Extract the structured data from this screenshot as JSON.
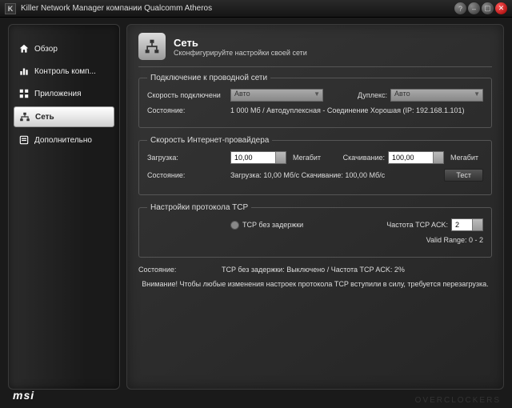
{
  "window": {
    "title": "Killer Network Manager компании Qualcomm Atheros",
    "logo": "K"
  },
  "sidebar": {
    "items": [
      {
        "key": "overview",
        "label": "Обзор"
      },
      {
        "key": "control",
        "label": "Контроль комп..."
      },
      {
        "key": "apps",
        "label": "Приложения"
      },
      {
        "key": "network",
        "label": "Сеть"
      },
      {
        "key": "extra",
        "label": "Дополнительно"
      }
    ]
  },
  "header": {
    "title": "Сеть",
    "subtitle": "Сконфигурируйте настройки своей сети"
  },
  "wired": {
    "legend": "Подключение к проводной сети",
    "speed_label": "Скорость подключени",
    "speed_value": "Авто",
    "duplex_label": "Дуплекс:",
    "duplex_value": "Авто",
    "status_label": "Состояние:",
    "status_value": "1 000 Мб / Автодуплексная - Соединение Хорошая (IP: 192.168.1.101)"
  },
  "isp": {
    "legend": "Скорость Интернет-провайдера",
    "upload_label": "Загрузка:",
    "upload_value": "10,00",
    "upload_unit": "Мегабит",
    "download_label": "Скачивание:",
    "download_value": "100,00",
    "download_unit": "Мегабит",
    "status_label": "Состояние:",
    "status_value": "Загрузка: 10,00 Мб/с Скачивание: 100,00 Мб/с",
    "test_btn": "Тест"
  },
  "tcp": {
    "legend": "Настройки протокола TCP",
    "nodelay_label": "TCP без задержки",
    "ack_label": "Частота TCP ACK:",
    "ack_value": "2",
    "range_label": "Valid Range: 0 - 2"
  },
  "status": {
    "label": "Состояние:",
    "value": "TCP без задержки: Выключено / Частота TCP ACK: 2%"
  },
  "warning": "Внимание! Чтобы любые изменения настроек протокола TCP вступили в силу, требуется перезагрузка.",
  "brand": "msi",
  "watermark": "OVERCLOCKERS"
}
